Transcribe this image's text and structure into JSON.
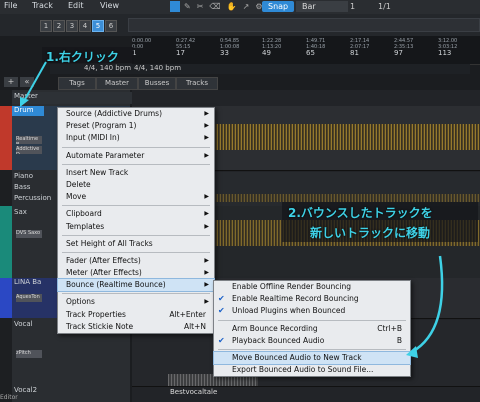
{
  "menubar": {
    "items": [
      "File",
      "Track",
      "Edit",
      "View"
    ],
    "snap": "Snap",
    "bar": "Bar",
    "counter": "1",
    "counter2": "1/1"
  },
  "number_buttons": [
    "1",
    "2",
    "3",
    "4",
    "5",
    "6"
  ],
  "ruler": {
    "bars": [
      "1",
      "17",
      "33",
      "49",
      "65",
      "81",
      "97",
      "113"
    ],
    "times": [
      "0:00.00",
      "0:27.42",
      "0:54.85",
      "1:22.28",
      "1:49.71",
      "2:17.14",
      "2:44.57",
      "3:12.00"
    ],
    "frames": [
      "0:00",
      "55:15",
      "1:00:08",
      "1:13:20",
      "1:40:18",
      "2:07:17",
      "2:35:13",
      "3:03:12"
    ]
  },
  "tempo": {
    "left": "4/4, 140 bpm",
    "right": "4/4, 140 bpm"
  },
  "tabs": {
    "tags": "Tags",
    "master": "Master",
    "busses": "Busses",
    "tracks": "Tracks"
  },
  "tracks": {
    "master": "Master",
    "drum": "Drum",
    "drum_sub1": "Realtime B",
    "drum_sub2": "Addictive D",
    "piano": "Piano",
    "bass": "Bass",
    "percussion": "Percussion",
    "sax": "Sax",
    "sax_sub": "DVS Saxo",
    "lina": "LINA Ba",
    "lina_sub": "AquesTon",
    "vocal": "Vocal",
    "vocal_sub": "zPitch",
    "vocal2": "Vocal2",
    "bottom_clip": "Bestvocaltale",
    "footer": "Editor"
  },
  "context_menu": {
    "items": [
      {
        "label": "Source (Addictive Drums)",
        "arrow": true
      },
      {
        "label": "Preset (Program 1)",
        "arrow": true
      },
      {
        "label": "Input (MIDI In)",
        "arrow": true
      },
      {
        "sep": true
      },
      {
        "label": "Automate Parameter",
        "arrow": true
      },
      {
        "sep": true
      },
      {
        "label": "Insert New Track"
      },
      {
        "label": "Delete"
      },
      {
        "label": "Move",
        "arrow": true
      },
      {
        "sep": true
      },
      {
        "label": "Clipboard",
        "arrow": true
      },
      {
        "label": "Templates",
        "arrow": true
      },
      {
        "sep": true
      },
      {
        "label": "Set Height of All Tracks"
      },
      {
        "sep": true
      },
      {
        "label": "Fader (After Effects)",
        "arrow": true
      },
      {
        "label": "Meter (After Effects)",
        "arrow": true
      },
      {
        "label": "Bounce (Realtime Bounce)",
        "arrow": true,
        "hl": true
      },
      {
        "sep": true
      },
      {
        "label": "Options",
        "arrow": true
      },
      {
        "label": "Track Properties",
        "shortcut": "Alt+Enter"
      },
      {
        "label": "Track Stickie Note",
        "shortcut": "Alt+N"
      }
    ]
  },
  "bounce_submenu": {
    "items": [
      {
        "label": "Enable Offline Render Bouncing",
        "check": false
      },
      {
        "label": "Enable Realtime Record Bouncing",
        "check": true
      },
      {
        "label": "Unload Plugins when Bounced",
        "check": true
      },
      {
        "sep": true
      },
      {
        "label": "Arm Bounce Recording",
        "shortcut": "Ctrl+B",
        "check": false
      },
      {
        "label": "Playback Bounced Audio",
        "shortcut": "B",
        "check": true
      },
      {
        "sep": true
      },
      {
        "label": "Move Bounced Audio to New Track",
        "hl": true,
        "check": false
      },
      {
        "label": "Export Bounced Audio to Sound File...",
        "check": false
      }
    ],
    "check_mark": "✔"
  },
  "annotations": {
    "step1": "1.右クリック",
    "step2_line1": "2.バウンスしたトラックを",
    "step2_line2": "新しいトラックに移動"
  },
  "colors": {
    "accent": "#3ed1e6",
    "highlight": "#2f8ad6"
  }
}
